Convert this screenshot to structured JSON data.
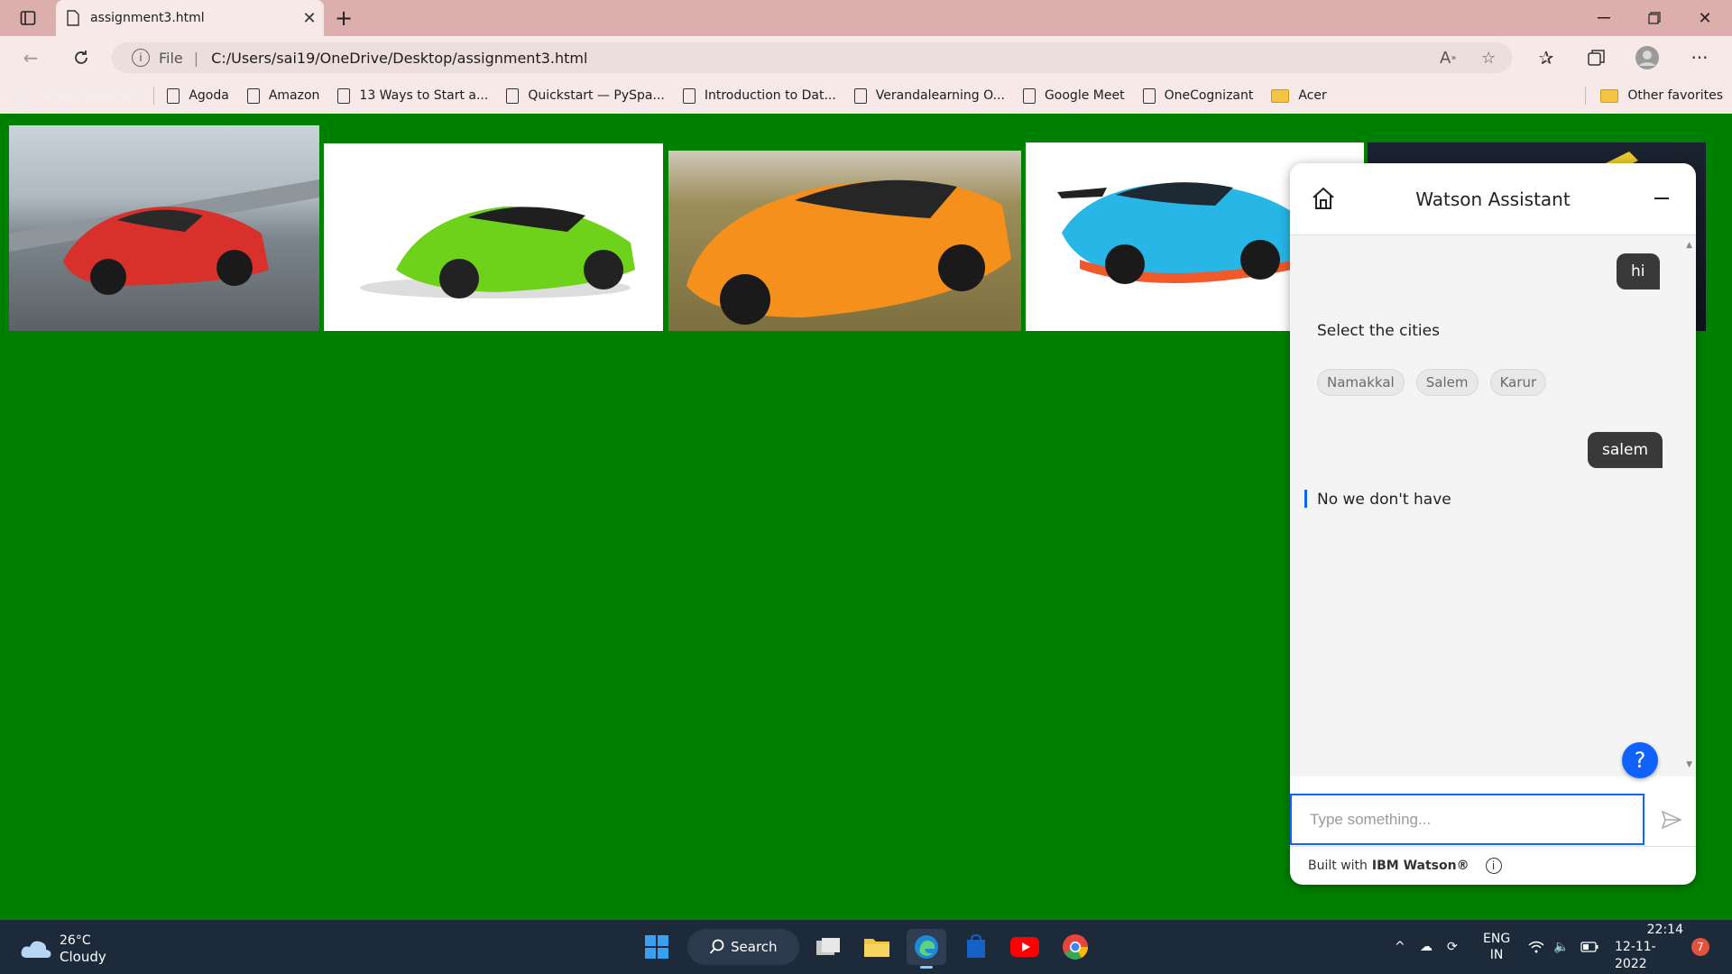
{
  "browser": {
    "tab_title": "assignment3.html",
    "new_tab_symbol": "+",
    "url_prefix": "File",
    "url": "C:/Users/sai19/OneDrive/Desktop/assignment3.html"
  },
  "favorites": {
    "items": [
      {
        "label": "Import favorites",
        "kind": "doc",
        "faded": true
      },
      {
        "label": "Agoda",
        "kind": "doc"
      },
      {
        "label": "Amazon",
        "kind": "doc"
      },
      {
        "label": "13 Ways to Start a...",
        "kind": "doc"
      },
      {
        "label": "Quickstart — PySpa...",
        "kind": "doc"
      },
      {
        "label": "Introduction to Dat...",
        "kind": "doc"
      },
      {
        "label": "Verandalearning O...",
        "kind": "doc"
      },
      {
        "label": "Google Meet",
        "kind": "doc"
      },
      {
        "label": "OneCognizant",
        "kind": "doc"
      },
      {
        "label": "Acer",
        "kind": "folder"
      }
    ],
    "other": "Other favorites"
  },
  "page": {
    "background": "#008000",
    "cars": [
      {
        "name": "red-lamborghini-image",
        "color": "#d8302a"
      },
      {
        "name": "green-lamborghini-image",
        "color": "#6fd21a"
      },
      {
        "name": "orange-lamborghini-image",
        "color": "#f5901c"
      },
      {
        "name": "blue-lamborghini-image",
        "color": "#27b6e6"
      },
      {
        "name": "dark-car-image",
        "color": "#1b2330"
      }
    ]
  },
  "watson": {
    "title": "Watson Assistant",
    "messages": {
      "user1": "hi",
      "bot1": "Select the cities",
      "options": [
        "Namakkal",
        "Salem",
        "Karur"
      ],
      "user2": "salem",
      "bot2": "No we don't have"
    },
    "input_placeholder": "Type something...",
    "help_symbol": "?",
    "footer_prefix": "Built with",
    "footer_brand": "IBM Watson®",
    "accent": "#0f62fe"
  },
  "taskbar": {
    "weather_temp": "26°C",
    "weather_desc": "Cloudy",
    "search_label": "Search",
    "lang_top": "ENG",
    "lang_bottom": "IN",
    "time": "22:14",
    "date": "12-11-2022",
    "notification_count": "7"
  }
}
